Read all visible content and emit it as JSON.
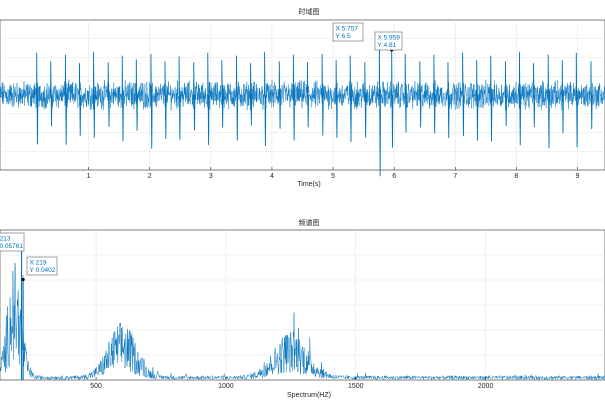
{
  "chart_data": [
    {
      "type": "line",
      "title": "时域图",
      "xlabel": "Time(s)",
      "ylabel": "",
      "xlim": [
        -0.45,
        9.45
      ],
      "ylim": [
        -8,
        8
      ],
      "x_ticks": [
        1,
        2,
        3,
        4,
        5,
        6,
        7,
        8,
        9
      ],
      "grid": true,
      "series_color": "#0072BD",
      "beat_times": [
        0.15,
        0.38,
        0.62,
        0.85,
        1.08,
        1.32,
        1.55,
        1.78,
        2.02,
        2.25,
        2.48,
        2.72,
        2.95,
        3.18,
        3.42,
        3.65,
        3.88,
        4.12,
        4.35,
        4.58,
        4.82,
        5.05,
        5.28,
        5.52,
        5.757,
        5.959,
        6.18,
        6.42,
        6.65,
        6.88,
        7.12,
        7.35,
        7.58,
        7.82,
        8.05,
        8.28,
        8.52,
        8.75,
        8.98,
        9.22
      ],
      "beat_peaks": [
        4.5,
        3.6,
        4.3,
        3.4,
        4.6,
        3.5,
        4.2,
        3.8,
        4.4,
        3.6,
        4.1,
        3.5,
        4.5,
        3.7,
        4.2,
        3.4,
        4.6,
        3.6,
        4.3,
        3.5,
        4.4,
        3.7,
        4.2,
        3.5,
        6.5,
        4.81,
        4.4,
        3.6,
        4.3,
        3.5,
        4.5,
        3.7,
        4.2,
        3.6,
        4.6,
        3.4,
        4.3,
        3.7,
        4.5,
        3.6
      ],
      "annotations": [
        {
          "x_label": "X",
          "x": "5.757",
          "y_label": "Y",
          "y": "6.5"
        },
        {
          "x_label": "X",
          "x": "5.959",
          "y_label": "Y",
          "y": "4.81"
        }
      ]
    },
    {
      "type": "line",
      "title": "频谱图",
      "xlabel": "Spectrum(HZ)",
      "ylabel": "",
      "xlim": [
        130,
        2460
      ],
      "ylim": [
        0,
        0.06
      ],
      "x_ticks": [
        500,
        1000,
        1500,
        2000
      ],
      "grid": true,
      "series_color": "#0072BD",
      "spectral_bumps": [
        {
          "center": 185,
          "width": 38,
          "height": 0.04
        },
        {
          "center": 600,
          "width": 75,
          "height": 0.019
        },
        {
          "center": 1250,
          "width": 90,
          "height": 0.016
        }
      ],
      "peaks": [
        {
          "x": 213,
          "y": 0.05761
        },
        {
          "x": 219,
          "y": 0.0402
        }
      ],
      "annotations": [
        {
          "x_label": "X",
          "x": "213",
          "y_label": "Y",
          "y": "0.05761"
        },
        {
          "x_label": "X",
          "x": "219",
          "y_label": "Y",
          "y": "0.0402"
        }
      ]
    }
  ]
}
